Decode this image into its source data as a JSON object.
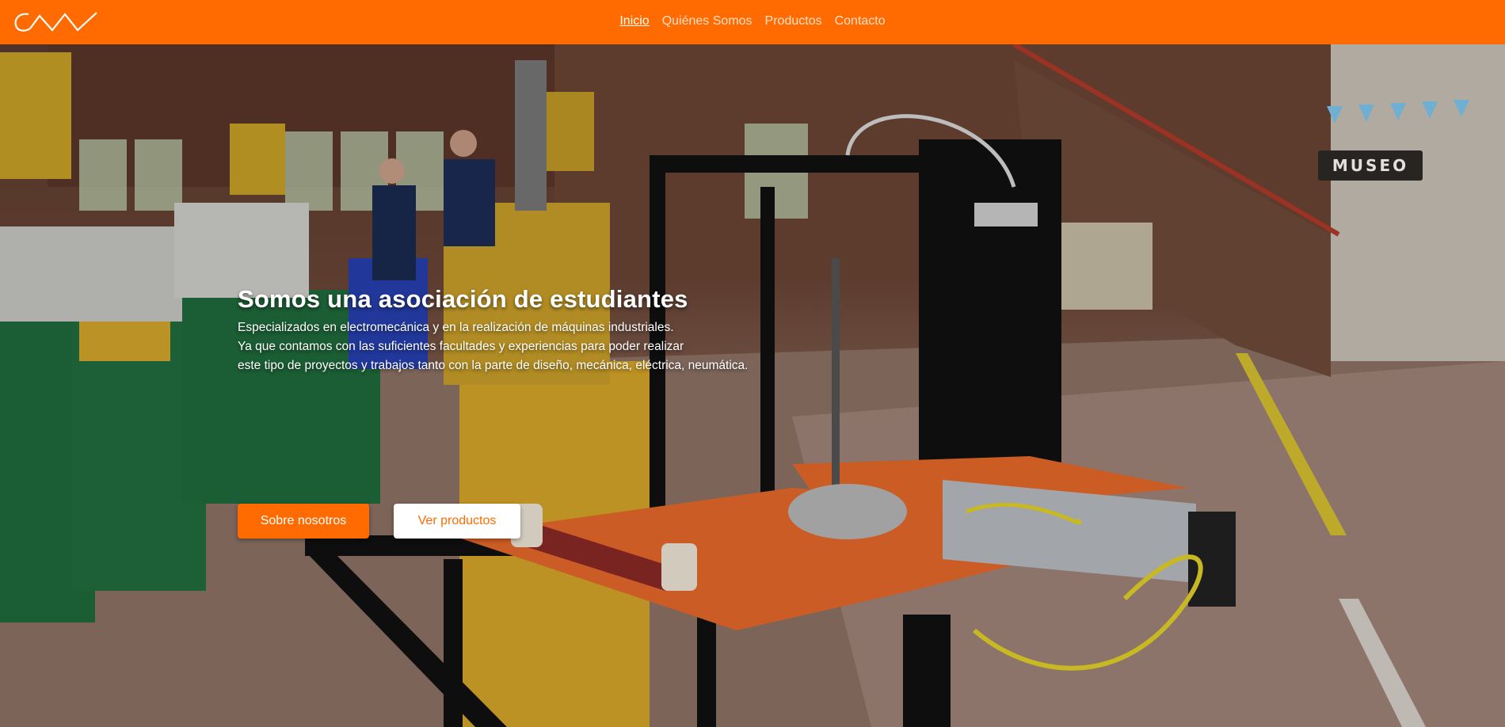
{
  "brand": {
    "logo_icon": "cnw-logo-icon"
  },
  "nav": {
    "items": [
      {
        "label": "Inicio",
        "active": true
      },
      {
        "label": "Quiénes Somos",
        "active": false
      },
      {
        "label": "Productos",
        "active": false
      },
      {
        "label": "Contacto",
        "active": false
      }
    ]
  },
  "hero": {
    "title": "Somos una asociación de estudiantes",
    "lines": [
      "Especializados en electromecánica y en la realización de máquinas industriales.",
      "Ya que contamos con las suficientes facultades y experiencias para poder realizar",
      "este tipo de proyectos y trabajos tanto con la parte de diseño, mecánica, eléctrica, neumática."
    ],
    "primary_button": "Sobre nosotros",
    "secondary_button": "Ver productos",
    "background_sign": "MUSEO"
  },
  "colors": {
    "accent": "#ff6b00",
    "white": "#ffffff"
  }
}
